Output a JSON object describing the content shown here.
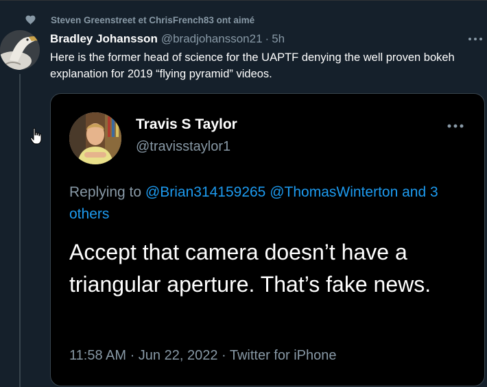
{
  "social_context": {
    "text": "Steven Greenstreet et ChrisFrench83 ont aimé",
    "icon": "heart-icon"
  },
  "tweet": {
    "display_name": "Bradley Johansson",
    "handle": "@bradjohansson21",
    "separator": "·",
    "time": "5h",
    "text": "Here is the former head of science for the UAPTF denying the well proven bokeh explanation for 2019 “flying pyramid” videos."
  },
  "quoted_tweet": {
    "display_name": "Travis S Taylor",
    "handle": "@travisstaylor1",
    "replying_prefix": "Replying to ",
    "mention_1": "@Brian314159265",
    "mention_2": "@ThomasWinterton",
    "and_others": "and 3 others",
    "text": "Accept that camera doesn’t have a triangular aperture. That’s fake news.",
    "timestamp": "11:58 AM · Jun 22, 2022 · Twitter for iPhone"
  },
  "colors": {
    "background": "#15202b",
    "quote_background": "#000000",
    "link": "#1d9bf0",
    "secondary_text": "#8899a6"
  }
}
